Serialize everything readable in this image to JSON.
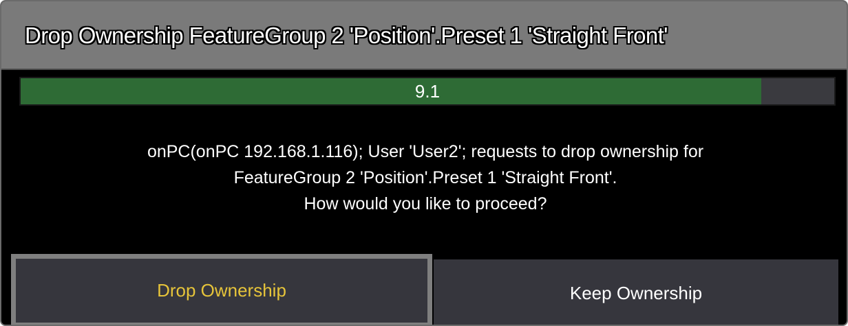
{
  "dialog": {
    "title": "Drop Ownership FeatureGroup 2 'Position'.Preset 1 'Straight Front'",
    "progress": {
      "label": "9.1",
      "fraction": 0.91,
      "fill_color": "#2e6b35"
    },
    "message_lines": [
      "onPC(onPC 192.168.1.116); User 'User2'; requests to drop ownership for",
      "FeatureGroup 2 'Position'.Preset 1 'Straight Front'.",
      "How would you like to proceed?"
    ],
    "buttons": {
      "drop_label": "Drop Ownership",
      "keep_label": "Keep Ownership"
    },
    "colors": {
      "accent_text": "#e6c43a",
      "title_bar": "#7a7a7a",
      "button_bg": "#36363d"
    }
  }
}
